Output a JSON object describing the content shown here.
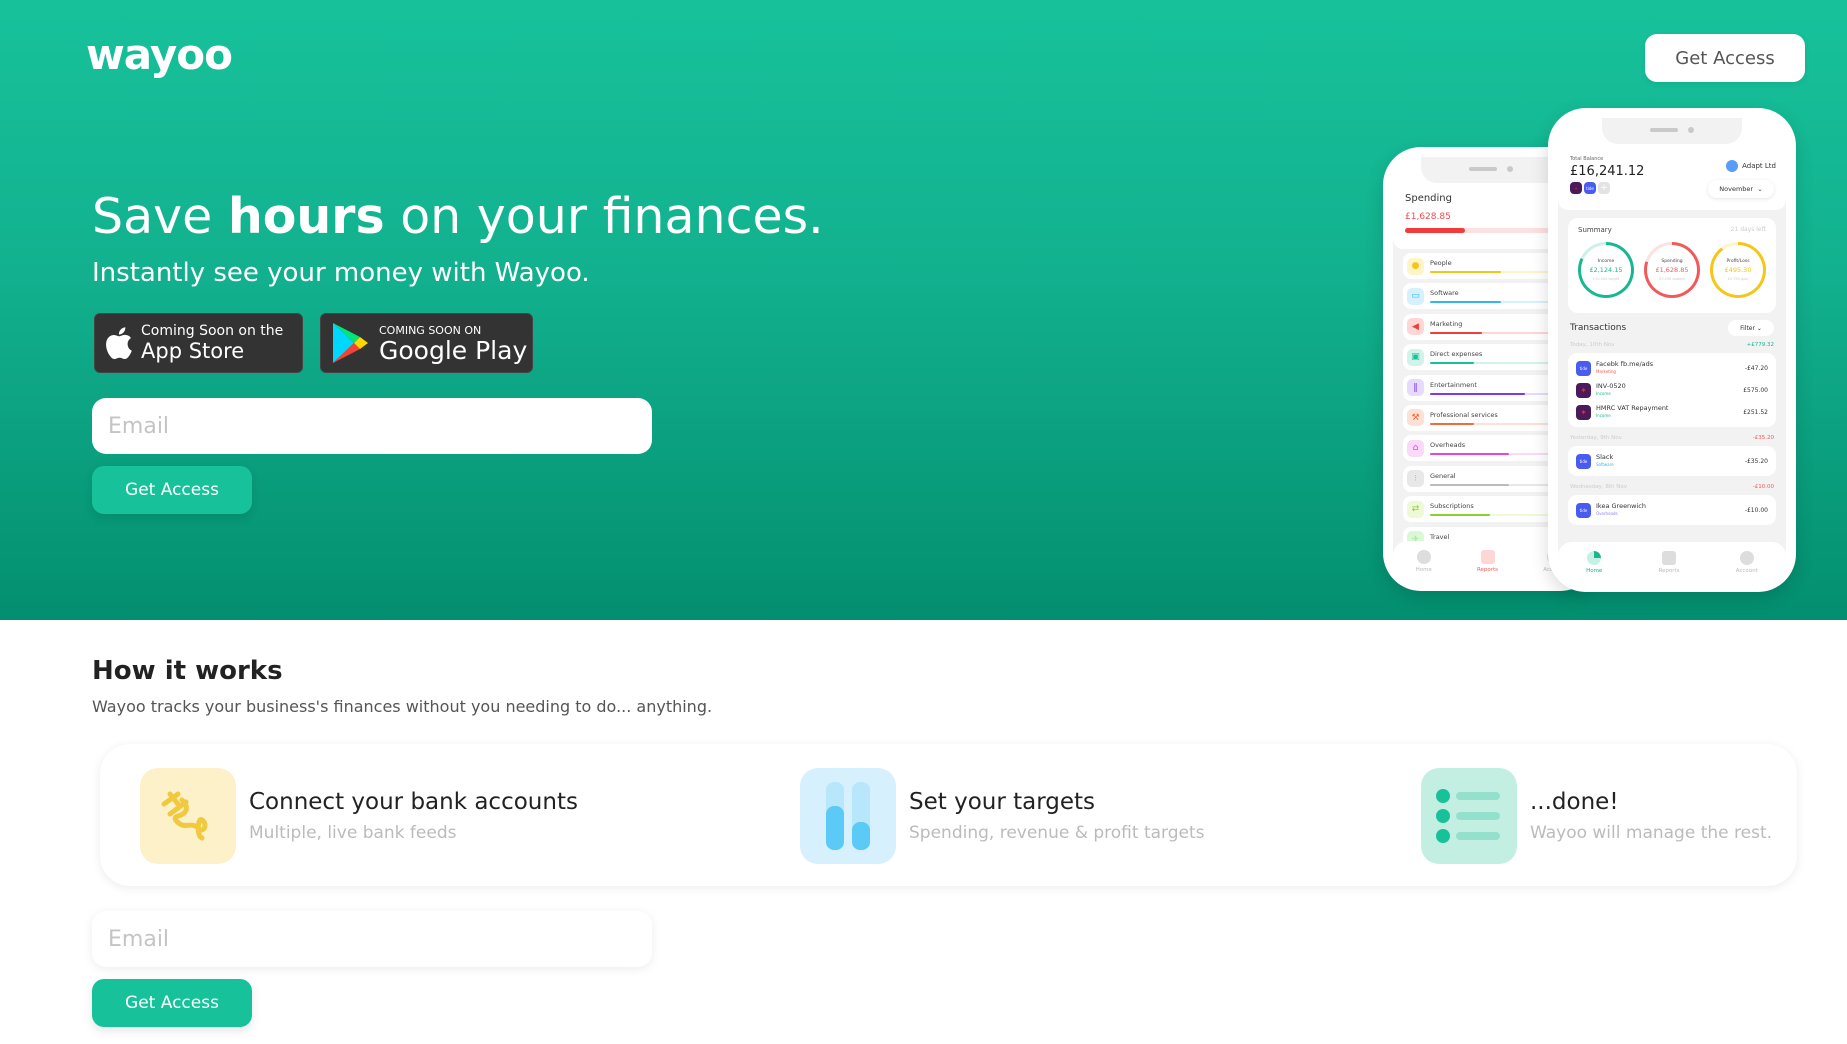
{
  "header": {
    "logo": "wayoo",
    "cta_label": "Get Access"
  },
  "hero": {
    "headline_pre": "Save ",
    "headline_bold": "hours",
    "headline_post": " on your finances.",
    "subheadline": "Instantly see your money with Wayoo.",
    "app_store": {
      "line1": "Coming Soon on the",
      "line2": "App Store"
    },
    "google_play": {
      "line1": "COMING SOON ON",
      "line2": "Google Play"
    },
    "email_placeholder": "Email",
    "cta_label": "Get Access"
  },
  "phone_spending": {
    "title": "Spending",
    "amount": "£1,628.85",
    "progress": 0.35,
    "categories": [
      {
        "name": "People",
        "color": "#f5c518",
        "bg": "#fff3c8",
        "progress": 0.45,
        "icon": "person-icon"
      },
      {
        "name": "Software",
        "color": "#34b6ee",
        "bg": "#d6f0fd",
        "progress": 0.45,
        "icon": "laptop-icon"
      },
      {
        "name": "Marketing",
        "color": "#f23c3c",
        "bg": "#fdd6d6",
        "progress": 0.33,
        "icon": "megaphone-icon"
      },
      {
        "name": "Direct expenses",
        "color": "#17c29b",
        "bg": "#d3f3ea",
        "progress": 0.28,
        "icon": "box-icon"
      },
      {
        "name": "Entertainment",
        "color": "#7c3aed",
        "bg": "#e6dbfb",
        "progress": 0.6,
        "icon": "cutlery-icon"
      },
      {
        "name": "Professional services",
        "color": "#f26a3c",
        "bg": "#fde0d6",
        "progress": 0.28,
        "icon": "gavel-icon"
      },
      {
        "name": "Overheads",
        "color": "#e845e0",
        "bg": "#fbd9f9",
        "progress": 0.5,
        "icon": "home-icon"
      },
      {
        "name": "General",
        "color": "#bbbbbb",
        "bg": "#e8e8e8",
        "progress": 0.5,
        "icon": "grid-icon"
      },
      {
        "name": "Subscriptions",
        "color": "#8bd12a",
        "bg": "#eefad6",
        "progress": 0.38,
        "icon": "repeat-icon"
      },
      {
        "name": "Travel",
        "color": "#a6e8a0",
        "bg": "#daf7d6",
        "progress": 1.0,
        "icon": "plane-icon"
      }
    ],
    "nav": [
      "Home",
      "Reports",
      "Account"
    ]
  },
  "phone_home": {
    "total_label": "Total Balance",
    "total": "£16,241.12",
    "org": "Adapt Ltd",
    "org_logo": "adapt",
    "month": "November",
    "summary": {
      "title": "Summary",
      "days_left": "21 days left",
      "rings": [
        {
          "label": "Income",
          "value": "£2,124.15",
          "sub": "£10,000 target",
          "color": "#17b88f",
          "track": "#ccf1e6",
          "progress": 0.82
        },
        {
          "label": "Spending",
          "value": "£1,628.85",
          "sub": "£5,250 budget",
          "color": "#f25a5a",
          "track": "#fde0e0",
          "progress": 0.8
        },
        {
          "label": "Profit/Loss",
          "value": "£495.30",
          "sub": "£4,750 goal",
          "color": "#f5c518",
          "track": "#fff3c8",
          "progress": 0.9
        }
      ]
    },
    "transactions_title": "Transactions",
    "filter_label": "Filter",
    "groups": [
      {
        "day": "Today, 10th Nov",
        "total": "+£779.32",
        "total_color": "#17b88f",
        "items": [
          {
            "name": "Facebk fb.me/ads",
            "category": "Marketing",
            "cat_color": "#f25a5a",
            "amount": "-£47.20",
            "bank": "tide"
          },
          {
            "name": "INV-0520",
            "category": "Income",
            "cat_color": "#17b88f",
            "amount": "£575.00",
            "bank": "natwest"
          },
          {
            "name": "HMRC VAT Repayment",
            "category": "Income",
            "cat_color": "#17b88f",
            "amount": "£251.52",
            "bank": "natwest"
          }
        ]
      },
      {
        "day": "Yesterday, 9th Nov",
        "total": "-£35.20",
        "total_color": "#f25a5a",
        "items": [
          {
            "name": "Slack",
            "category": "Software",
            "cat_color": "#34b6ee",
            "amount": "-£35.20",
            "bank": "tide"
          }
        ]
      },
      {
        "day": "Wednesday, 8th Nov",
        "total": "-£10.00",
        "total_color": "#f25a5a",
        "items": [
          {
            "name": "Ikea Greenwich",
            "category": "Overheads",
            "cat_color": "#8b7cf6",
            "amount": "-£10.00",
            "bank": "tide"
          }
        ]
      }
    ],
    "nav": [
      "Home",
      "Reports",
      "Account"
    ]
  },
  "how_it_works": {
    "title": "How it works",
    "subtitle": "Wayoo tracks your business's finances without you needing to do... anything.",
    "steps": [
      {
        "title": "Connect your bank accounts",
        "desc": "Multiple, live bank feeds",
        "icon": "plug-icon"
      },
      {
        "title": "Set your targets",
        "desc": "Spending, revenue & profit targets",
        "icon": "bar-targets-icon"
      },
      {
        "title": "...done!",
        "desc": "Wayoo will manage the rest.",
        "icon": "checklist-icon"
      }
    ],
    "email_placeholder": "Email",
    "cta_label": "Get Access"
  },
  "colors": {
    "brand": "#17c29b",
    "brand_dark": "#038f6f"
  }
}
